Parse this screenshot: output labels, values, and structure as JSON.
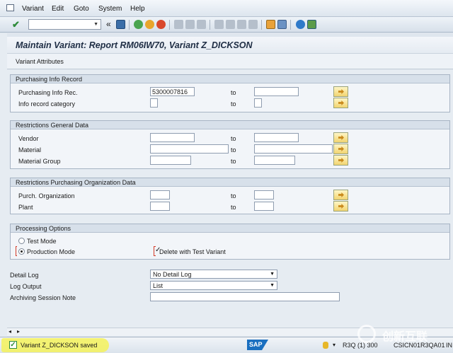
{
  "menu": {
    "items": [
      "Variant",
      "Edit",
      "Goto",
      "System",
      "Help"
    ]
  },
  "toolbar": {
    "command_field_value": "",
    "icons": [
      "enter-icon",
      "back-arrows-icon",
      "save-icon",
      "back-icon",
      "exit-icon",
      "cancel-icon",
      "print-icon",
      "find-icon",
      "find-next-icon",
      "first-page-icon",
      "prev-page-icon",
      "next-page-icon",
      "last-page-icon",
      "create-session-icon",
      "shortcut-icon",
      "help-icon",
      "customize-layout-icon"
    ]
  },
  "title": "Maintain Variant: Report RM06IW70, Variant Z_DICKSON",
  "app_toolbar": {
    "variant_attributes": "Variant Attributes"
  },
  "groups": {
    "purchasing_info_record": {
      "title": "Purchasing Info Record",
      "rows": [
        {
          "label": "Purchasing Info Rec.",
          "from": "5300007816",
          "to_label": "to",
          "to": ""
        },
        {
          "label": "Info record category",
          "from": "",
          "to_label": "to",
          "to": ""
        }
      ]
    },
    "restrictions_general": {
      "title": "Restrictions General Data",
      "rows": [
        {
          "label": "Vendor",
          "from": "",
          "to_label": "to",
          "to": ""
        },
        {
          "label": "Material",
          "from": "",
          "to_label": "to",
          "to": ""
        },
        {
          "label": "Material Group",
          "from": "",
          "to_label": "to",
          "to": ""
        }
      ]
    },
    "restrictions_purch_org": {
      "title": "Restrictions Purchasing Organization Data",
      "rows": [
        {
          "label": "Purch. Organization",
          "from": "",
          "to_label": "to",
          "to": ""
        },
        {
          "label": "Plant",
          "from": "",
          "to_label": "to",
          "to": ""
        }
      ]
    },
    "processing_options": {
      "title": "Processing Options",
      "test_mode": "Test Mode",
      "production_mode": "Production Mode",
      "selected_mode": "Production Mode",
      "delete_with_test_variant": "Delete with Test Variant",
      "delete_checked": true
    }
  },
  "bottom_fields": {
    "detail_log_label": "Detail Log",
    "detail_log_value": "No Detail Log",
    "log_output_label": "Log Output",
    "log_output_value": "List",
    "archiving_label": "Archiving Session Note",
    "archiving_value": ""
  },
  "statusbar": {
    "message": "Variant Z_DICKSON saved",
    "logo": "SAP",
    "system": "R3Q (1) 300",
    "server": "CSICN01R3QA01",
    "mode": "IN",
    "watermark": "创新互联"
  },
  "colors": {
    "ok_green": "#2e8b3a",
    "highlight_yellow": "#f4f25a",
    "sap_blue": "#1a6fc0"
  }
}
